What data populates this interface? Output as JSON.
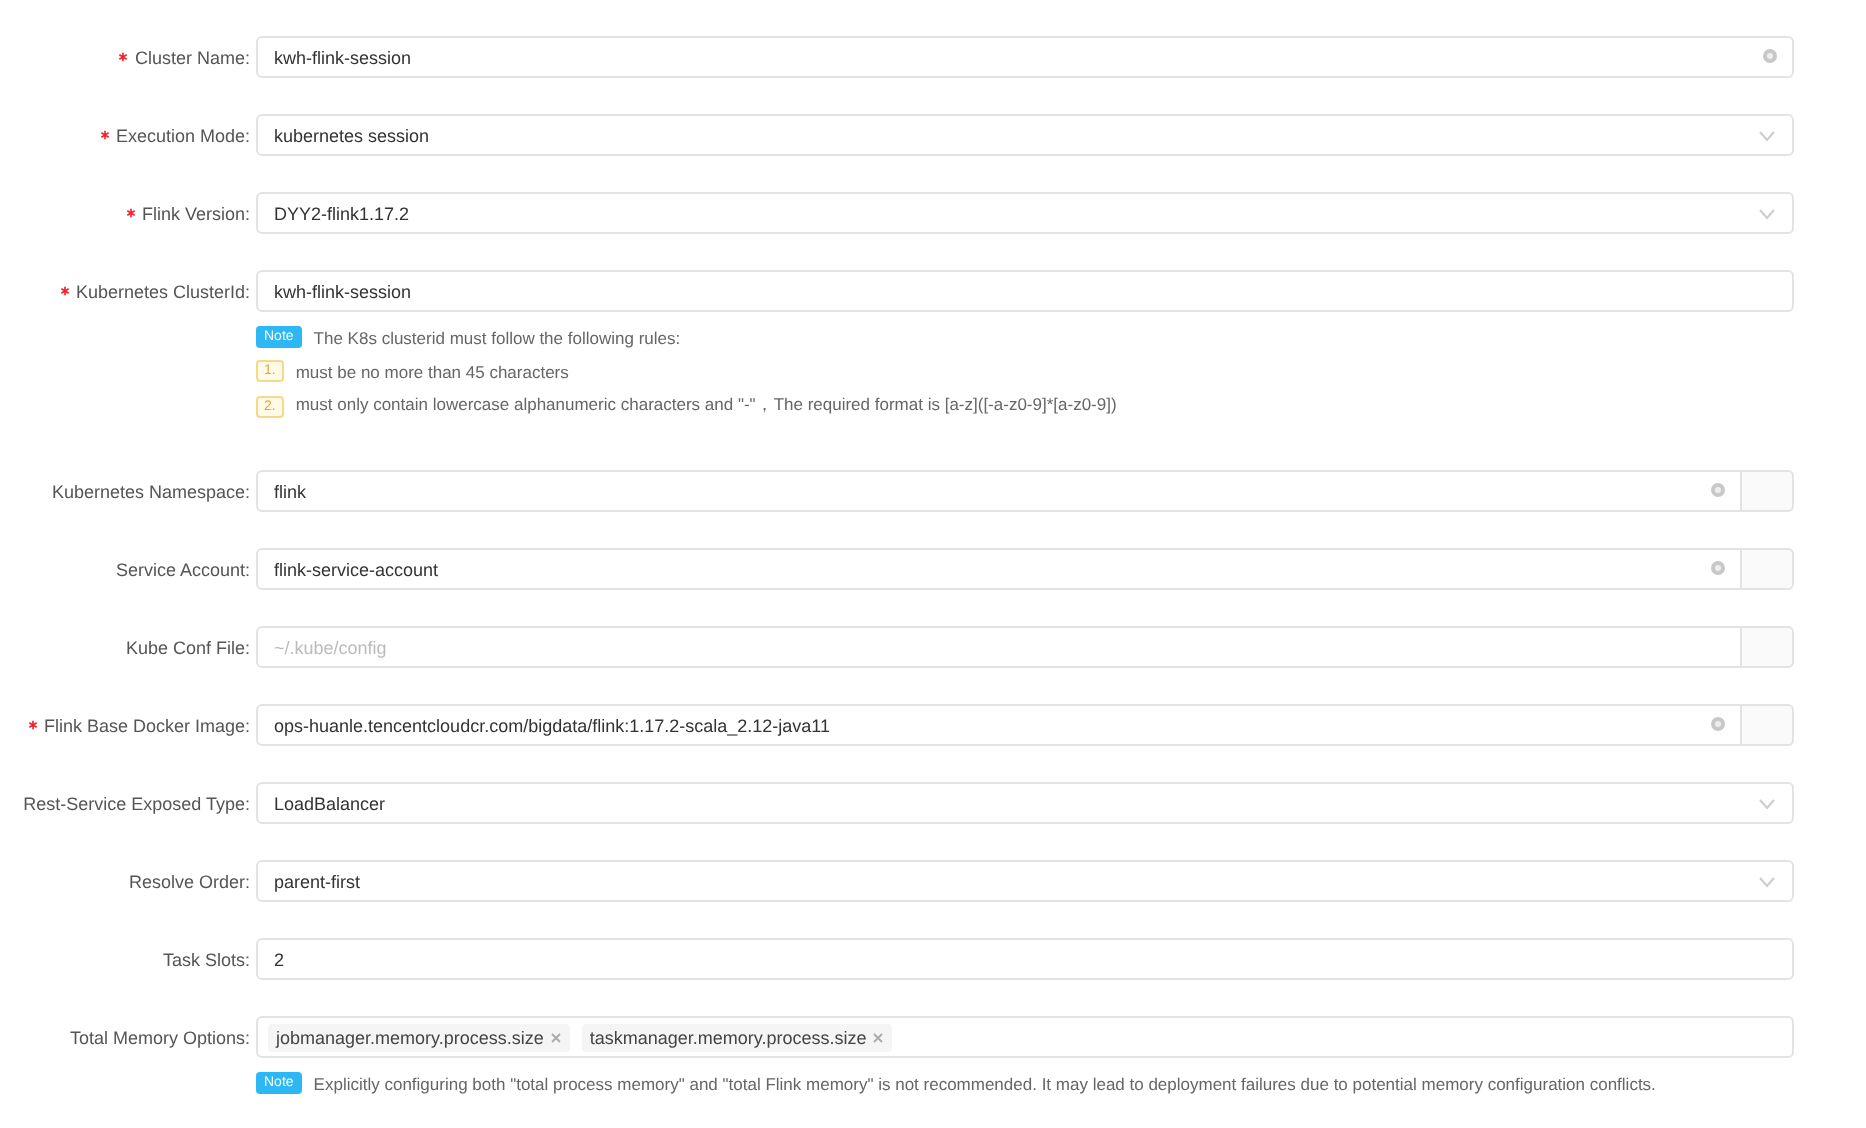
{
  "fields": [
    {
      "label": "Cluster Name:",
      "required": true,
      "kind": "input",
      "value": "kwh-flink-session",
      "clearable": true,
      "addon": false
    },
    {
      "label": "Execution Mode:",
      "required": true,
      "kind": "select",
      "value": "kubernetes session"
    },
    {
      "label": "Flink Version:",
      "required": true,
      "kind": "select",
      "value": "DYY2-flink1.17.2"
    },
    {
      "label": "Kubernetes ClusterId:",
      "required": true,
      "kind": "input",
      "value": "kwh-flink-session",
      "clearable": false,
      "addon": false,
      "note": {
        "tag": "Note",
        "text": "The K8s clusterid must follow the following rules:",
        "rules": [
          {
            "number": "1.",
            "text": "must be no more than 45 characters"
          },
          {
            "number": "2.",
            "text": "must only contain lowercase alphanumeric characters and \"-\"，The required format is [a-z]([-a-z0-9]*[a-z0-9])"
          }
        ]
      }
    },
    {
      "label": "Kubernetes Namespace:",
      "required": false,
      "kind": "input",
      "value": "flink",
      "clearable": true,
      "addon": true
    },
    {
      "label": "Service Account:",
      "required": false,
      "kind": "input",
      "value": "flink-service-account",
      "clearable": true,
      "addon": true
    },
    {
      "label": "Kube Conf File:",
      "required": false,
      "kind": "input",
      "placeholder": "~/.kube/config",
      "clearable": false,
      "addon": true
    },
    {
      "label": "Flink Base Docker Image:",
      "required": true,
      "kind": "input",
      "value": "ops-huanle.tencentcloudcr.com/bigdata/flink:1.17.2-scala_2.12-java11",
      "clearable": true,
      "addon": true
    },
    {
      "label": "Rest-Service Exposed Type:",
      "required": false,
      "kind": "select",
      "value": "LoadBalancer"
    },
    {
      "label": "Resolve Order:",
      "required": false,
      "kind": "select",
      "value": "parent-first"
    },
    {
      "label": "Task Slots:",
      "required": false,
      "kind": "input",
      "value": "2",
      "clearable": false,
      "addon": false
    },
    {
      "label": "Total Memory Options:",
      "required": false,
      "kind": "tags",
      "tags": [
        "jobmanager.memory.process.size",
        "taskmanager.memory.process.size"
      ],
      "note": {
        "tag": "Note",
        "text": "Explicitly configuring both \"total process memory\" and \"total Flink memory\" is not recommended. It may lead to deployment failures due to potential memory configuration conflicts."
      }
    }
  ]
}
